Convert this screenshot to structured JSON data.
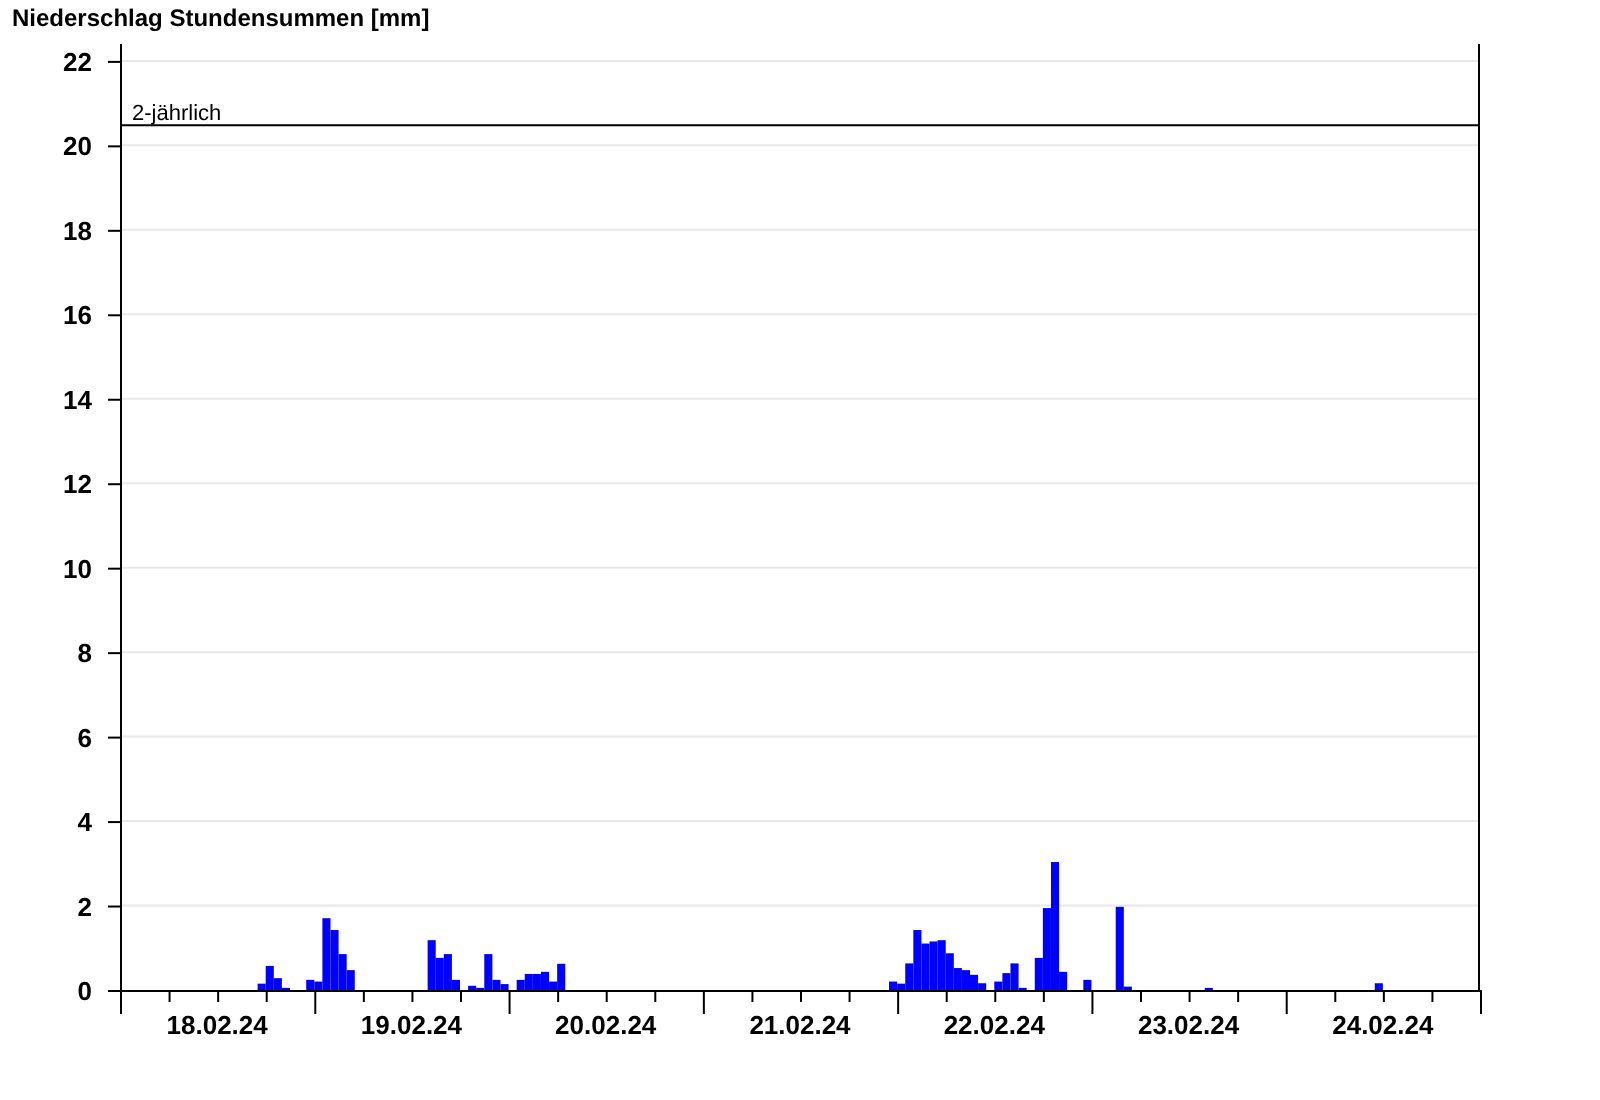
{
  "chart": {
    "chart_data": {
      "type": "bar",
      "title": "Niederschlag Stundensummen [mm]",
      "categories": [
        null,
        null,
        null,
        null,
        null,
        null,
        null,
        null,
        null,
        null,
        null,
        null,
        "18.02.24",
        null,
        null,
        null,
        null,
        null,
        null,
        null,
        null,
        null,
        null,
        null,
        null,
        null,
        null,
        null,
        null,
        null,
        null,
        null,
        null,
        null,
        null,
        null,
        "19.02.24",
        null,
        null,
        null,
        null,
        null,
        null,
        null,
        null,
        null,
        null,
        null,
        null,
        null,
        null,
        null,
        null,
        null,
        null,
        null,
        null,
        null,
        null,
        null,
        "20.02.24",
        null,
        null,
        null,
        null,
        null,
        null,
        null,
        null,
        null,
        null,
        null,
        null,
        null,
        null,
        null,
        null,
        null,
        null,
        null,
        null,
        null,
        null,
        null,
        "21.02.24",
        null,
        null,
        null,
        null,
        null,
        null,
        null,
        null,
        null,
        null,
        null,
        null,
        null,
        null,
        null,
        null,
        null,
        null,
        null,
        null,
        null,
        null,
        null,
        "22.02.24",
        null,
        null,
        null,
        null,
        null,
        null,
        null,
        null,
        null,
        null,
        null,
        null,
        null,
        null,
        null,
        null,
        null,
        null,
        null,
        null,
        null,
        null,
        null,
        "23.02.24",
        null,
        null,
        null,
        null,
        null,
        null,
        null,
        null,
        null,
        null,
        null,
        null,
        null,
        null,
        null,
        null,
        null,
        null,
        null,
        null,
        null,
        null,
        null,
        "24.02.24",
        null,
        null,
        null,
        null,
        null,
        null,
        null,
        null,
        null,
        null,
        null
      ],
      "series": [
        {
          "color": "#0000ff",
          "values": [
            0,
            0,
            0,
            0,
            0,
            0,
            0,
            0,
            0,
            0,
            0,
            0,
            0,
            0,
            0,
            0,
            0,
            0.15,
            0.57,
            0.28,
            0.05,
            0,
            0,
            0.24,
            0.2,
            1.7,
            1.42,
            0.85,
            0.47,
            0,
            0,
            0,
            0,
            0,
            0,
            0,
            0,
            0,
            1.18,
            0.76,
            0.85,
            0.24,
            0,
            0.1,
            0.05,
            0.85,
            0.24,
            0.14,
            0,
            0.24,
            0.38,
            0.38,
            0.43,
            0.2,
            0.62,
            0,
            0,
            0,
            0,
            0,
            0,
            0,
            0,
            0,
            0,
            0,
            0,
            0,
            0,
            0,
            0,
            0,
            0,
            0,
            0,
            0,
            0,
            0,
            0,
            0,
            0,
            0,
            0,
            0,
            0,
            0,
            0,
            0,
            0,
            0,
            0,
            0,
            0,
            0,
            0,
            0.2,
            0.15,
            0.63,
            1.42,
            1.1,
            1.15,
            1.18,
            0.87,
            0.52,
            0.47,
            0.36,
            0.16,
            0,
            0.2,
            0.4,
            0.63,
            0.05,
            0,
            0.76,
            1.94,
            3.03,
            0.43,
            0,
            0,
            0.24,
            0,
            0,
            0,
            1.97,
            0.08,
            0,
            0,
            0,
            0,
            0,
            0,
            0,
            0,
            0,
            0.05,
            0,
            0,
            0,
            0,
            0,
            0,
            0,
            0,
            0,
            0,
            0,
            0,
            0,
            0,
            0,
            0,
            0,
            0,
            0,
            0,
            0.16,
            0,
            0,
            0,
            0,
            0,
            0,
            0,
            0,
            0,
            0,
            0,
            0
          ]
        }
      ],
      "ylim": [
        0,
        22.4
      ],
      "yticks": [
        0,
        2,
        4,
        6,
        8,
        10,
        12,
        14,
        16,
        18,
        20,
        22
      ],
      "grid": true,
      "ref_lines": [
        {
          "axis": "y",
          "value": 20.5,
          "label": "2-jährlich"
        }
      ]
    }
  }
}
